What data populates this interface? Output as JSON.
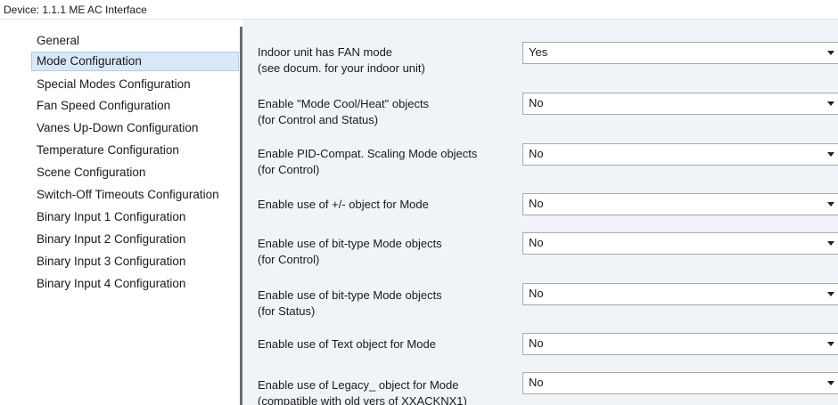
{
  "window": {
    "title": "Device: 1.1.1  ME AC Interface"
  },
  "sidebar": {
    "items": [
      {
        "label": "General",
        "selected": false
      },
      {
        "label": "Mode Configuration",
        "selected": true
      },
      {
        "label": "Special Modes Configuration",
        "selected": false
      },
      {
        "label": "Fan Speed Configuration",
        "selected": false
      },
      {
        "label": "Vanes Up-Down Configuration",
        "selected": false
      },
      {
        "label": "Temperature Configuration",
        "selected": false
      },
      {
        "label": "Scene Configuration",
        "selected": false
      },
      {
        "label": "Switch-Off Timeouts Configuration",
        "selected": false
      },
      {
        "label": "Binary Input 1 Configuration",
        "selected": false
      },
      {
        "label": "Binary Input 2 Configuration",
        "selected": false
      },
      {
        "label": "Binary Input 3 Configuration",
        "selected": false
      },
      {
        "label": "Binary Input 4 Configuration",
        "selected": false
      }
    ]
  },
  "params": [
    {
      "line1": "Indoor unit has FAN mode",
      "line2": "(see docum. for your indoor unit)",
      "value": "Yes"
    },
    {
      "line1": "Enable \"Mode Cool/Heat\" objects",
      "line2": "(for Control and Status)",
      "value": "No"
    },
    {
      "line1": "Enable PID-Compat. Scaling Mode objects",
      "line2": "(for Control)",
      "value": "No"
    },
    {
      "line1": "Enable use of +/- object for Mode",
      "line2": "",
      "value": "No"
    },
    {
      "line1": "Enable use of bit-type Mode objects",
      "line2": "(for Control)",
      "value": "No"
    },
    {
      "line1": "Enable use of bit-type Mode objects",
      "line2": "(for Status)",
      "value": "No"
    },
    {
      "line1": "Enable use of Text object for Mode",
      "line2": "",
      "value": "No"
    },
    {
      "line1": "Enable use of Legacy_ object for Mode",
      "line2": "(compatible with old vers of XXACKNX1)",
      "value": "No"
    }
  ]
}
